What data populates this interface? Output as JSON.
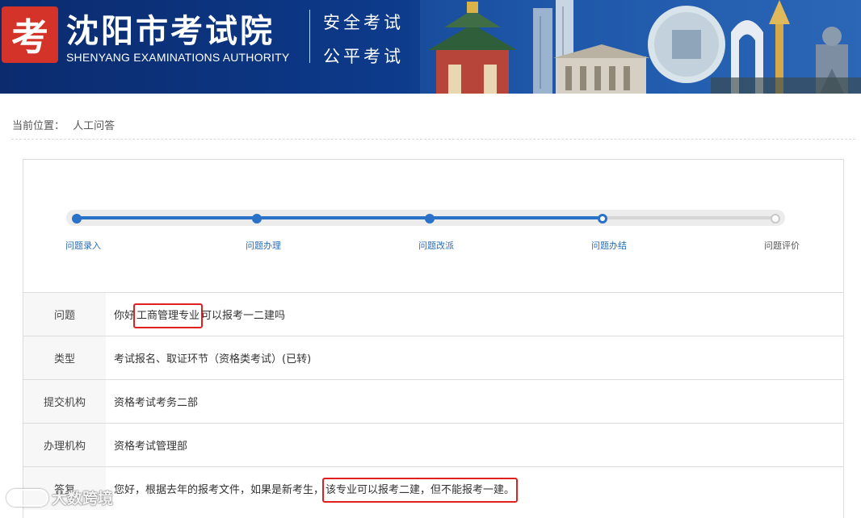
{
  "header": {
    "logo_char": "考",
    "org_name": "沈阳市考试院",
    "org_name_en": "SHENYANG EXAMINATIONS AUTHORITY",
    "slogan_1": "安全考试",
    "slogan_2": "公平考试",
    "colors": {
      "banner": "#0d3a8a",
      "logo_bg": "#d4332a"
    }
  },
  "breadcrumb": {
    "prefix": "当前位置：",
    "current": "人工问答"
  },
  "progress": {
    "steps": [
      {
        "label": "问题录入",
        "state": "done"
      },
      {
        "label": "问题办理",
        "state": "done"
      },
      {
        "label": "问题改派",
        "state": "done"
      },
      {
        "label": "问题办结",
        "state": "current"
      },
      {
        "label": "问题评价",
        "state": "pending"
      }
    ],
    "accent": "#2a72c8"
  },
  "details": {
    "question": {
      "label": "问题",
      "value_before": "你好",
      "value_highlight": "工商管理专业",
      "value_after": "可以报考一二建吗"
    },
    "type": {
      "label": "类型",
      "value": "考试报名、取证环节（资格类考试）(已转)"
    },
    "submit_org": {
      "label": "提交机构",
      "value": "资格考试考务二部"
    },
    "handle_org": {
      "label": "办理机构",
      "value": "资格考试管理部"
    },
    "answer": {
      "label": "答复",
      "value_before": "您好，根据去年的报考文件，如果是新考生，",
      "value_highlight": "该专业可以报考二建，但不能报考一建。"
    },
    "highlight_color": "#e02020"
  },
  "watermark": {
    "text": "大数跨境"
  }
}
